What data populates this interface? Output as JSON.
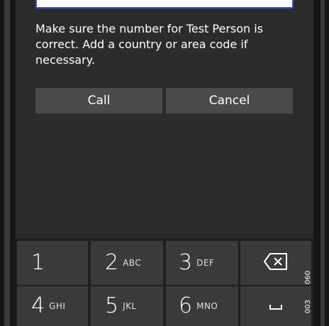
{
  "dialog": {
    "message": "Make sure the number for Test Person is correct. Add a country or area code if necessary.",
    "call_label": "Call",
    "cancel_label": "Cancel"
  },
  "keypad": {
    "keys": [
      {
        "num": "1",
        "letters": ""
      },
      {
        "num": "2",
        "letters": "ABC"
      },
      {
        "num": "3",
        "letters": "DEF"
      },
      {
        "num": "4",
        "letters": "GHI"
      },
      {
        "num": "5",
        "letters": "JKL"
      },
      {
        "num": "6",
        "letters": "MNO"
      }
    ],
    "backspace_icon": "backspace-icon",
    "space_icon": "space-icon"
  },
  "side_labels": [
    "060",
    "003"
  ]
}
